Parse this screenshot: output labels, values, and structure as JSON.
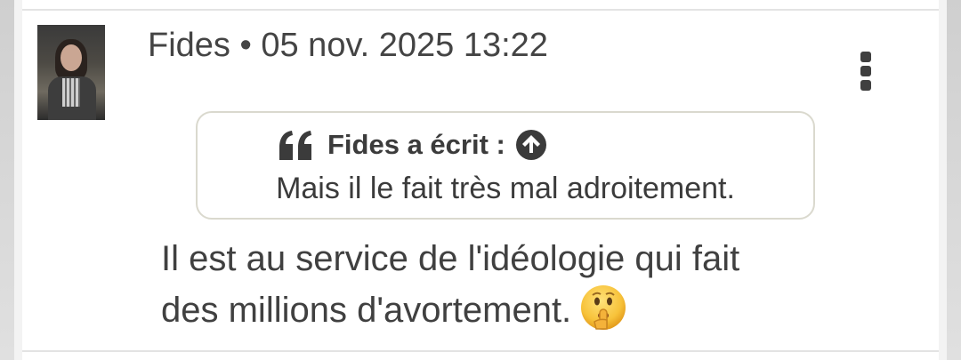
{
  "post": {
    "author": "Fides",
    "separator": "•",
    "timestamp": "05 nov. 2025 13:22",
    "menu_icon": "more-vertical-icon",
    "quote": {
      "icon": "quote-icon",
      "header": "Fides a écrit :",
      "jump_icon": "arrow-up-circle-icon",
      "text": "Mais il le fait très mal adroitement."
    },
    "body_line1": "Il est au service de l'idéologie qui fait",
    "body_line2": "des millions d'avortement.",
    "emoji": "shushing-face-emoji"
  },
  "colors": {
    "text": "#404040",
    "quote_border": "#dad9ce",
    "icon": "#3f3f3f"
  }
}
